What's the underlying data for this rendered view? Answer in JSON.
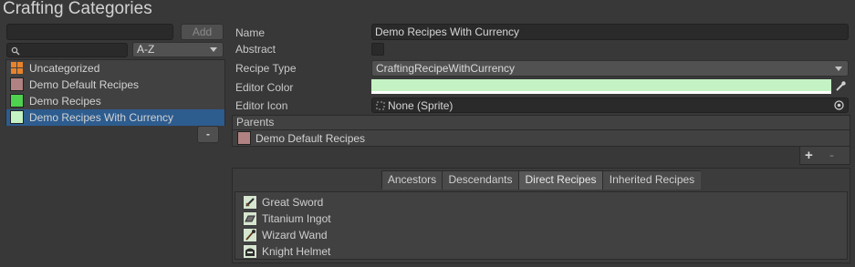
{
  "title": "Crafting Categories",
  "search": {
    "value": "",
    "placeholder": ""
  },
  "add_label": "Add",
  "sort": {
    "selected": "A-Z"
  },
  "categories": [
    {
      "label": "Uncategorized",
      "color": "#e8832a",
      "icon": "grid-icon"
    },
    {
      "label": "Demo Default Recipes",
      "color": "#b08282"
    },
    {
      "label": "Demo Recipes",
      "color": "#4fd24f"
    },
    {
      "label": "Demo Recipes With Currency",
      "color": "#c4f2c4",
      "selected": true
    }
  ],
  "remove_label": "-",
  "inspector": {
    "name_label": "Name",
    "name_value": "Demo Recipes With Currency",
    "abstract_label": "Abstract",
    "abstract_checked": false,
    "recipe_type_label": "Recipe Type",
    "recipe_type_value": "CraftingRecipeWithCurrency",
    "editor_color_label": "Editor Color",
    "editor_color_value": "#c4f2c4",
    "editor_icon_label": "Editor Icon",
    "editor_icon_value": "None (Sprite)",
    "parents_label": "Parents",
    "parents": [
      {
        "label": "Demo Default Recipes",
        "color": "#b08282"
      }
    ],
    "plus_label": "+",
    "minus_label": "-"
  },
  "tabs": [
    {
      "label": "Ancestors",
      "active": false
    },
    {
      "label": "Descendants",
      "active": false
    },
    {
      "label": "Direct Recipes",
      "active": true
    },
    {
      "label": "Inherited Recipes",
      "active": false
    }
  ],
  "recipes": [
    {
      "label": "Great Sword",
      "icon": "sword-icon"
    },
    {
      "label": "Titanium Ingot",
      "icon": "ingot-icon"
    },
    {
      "label": "Wizard Wand",
      "icon": "wand-icon"
    },
    {
      "label": "Knight Helmet",
      "icon": "helmet-icon"
    }
  ],
  "colors": {
    "background": "#383838",
    "selection": "#2d5c8f",
    "panel": "#414141"
  }
}
